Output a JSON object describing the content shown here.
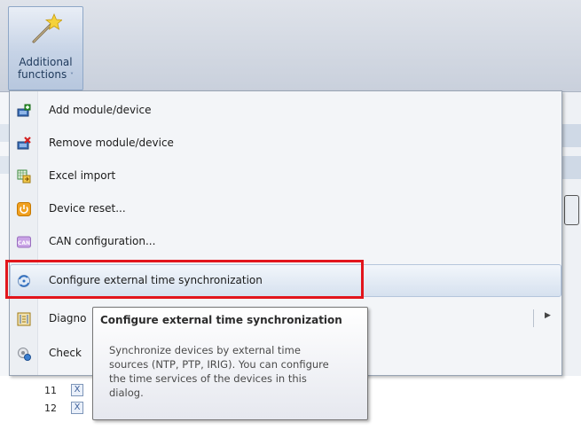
{
  "ribbon": {
    "button_label_line1": "Additional",
    "button_label_line2": "functions",
    "button_icon": "magic-wand-icon"
  },
  "menu": {
    "items": [
      {
        "label": "Add module/device",
        "icon": "add-device-icon"
      },
      {
        "label": "Remove module/device",
        "icon": "remove-device-icon"
      },
      {
        "label": "Excel import",
        "icon": "excel-import-icon"
      },
      {
        "label": "Device reset...",
        "icon": "power-reset-icon"
      },
      {
        "label": "CAN configuration...",
        "icon": "can-icon"
      },
      {
        "label": "Configure external time synchronization",
        "icon": "time-sync-icon"
      },
      {
        "label": "Diagno",
        "icon": "diagnostics-icon"
      },
      {
        "label": "Check",
        "icon": "check-icon"
      }
    ],
    "can_icon_text": "CAN"
  },
  "tooltip": {
    "title": "Configure external time synchronization",
    "body": "Synchronize devices by external time sources (NTP, PTP, IRIG). You can configure the time services of the devices in this dialog."
  },
  "background_rows": [
    {
      "number": "11",
      "check": "X"
    },
    {
      "number": "12",
      "check": "X"
    }
  ],
  "colors": {
    "highlight_box": "#e2151c",
    "menu_bg": "#f3f5f8"
  }
}
